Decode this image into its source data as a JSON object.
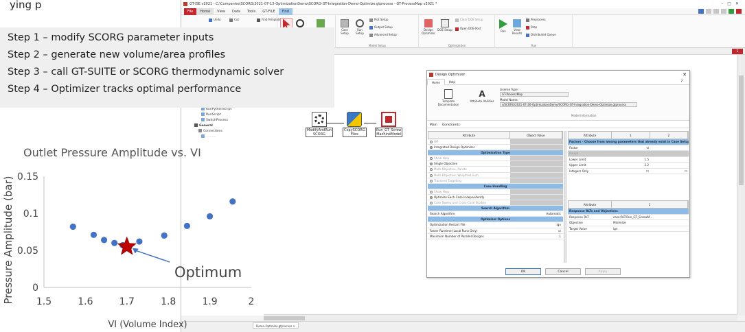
{
  "heading_partial": "ying p",
  "steps": [
    "Step 1 – modify SCORG parameter inputs",
    "Step 2 – generate new volume/area profiles",
    "Step 3 – call GT-SUITE or SCORG thermodynamic solver",
    "Step 4 – Optimizer tracks optimal performance"
  ],
  "app": {
    "title": "GT-ISE v2021 - C:\\Companies\\SCORG\\2021-07-13-OptimizationDemo\\SCORG-GT-Integration-Demo-Optimize.gtprocess - GT-ProcessMap v2021 *",
    "menu": [
      "File",
      "Home",
      "View",
      "Data",
      "Tools",
      "GT-FILE",
      "Find"
    ],
    "ribbon": {
      "undo": "Undo",
      "cut": "Cut",
      "find": "Find Template",
      "value": "d Value",
      "select": "Select",
      "link": "Link",
      "edit_parts": "Edit Parts in Spreadsheet",
      "case_setup": "Case Setup",
      "run_setup": "Run Setup",
      "plot_setup": "Plot Setup",
      "output_setup": "Output Setup",
      "advanced_setup": "Advanced Setup",
      "design_optimizer": "Design Optimizer",
      "doe_setup": "DOE Setup",
      "clear_doe_setup": "Clear DOE Setup",
      "open_doe_post": "Open DOE-Post",
      "run": "Run",
      "view_results": "View Results",
      "preprocess": "Preprocess",
      "stop": "Stop",
      "distributed_queue": "Distributed Queue",
      "group_map_mode": "Map Mode",
      "group_model_setup": "Model Setup",
      "group_optimization": "Optimization",
      "group_run": "Run"
    },
    "tree": [
      {
        "label": "RunPythonScript",
        "bold": false
      },
      {
        "label": "RunScript",
        "bold": false
      },
      {
        "label": "SwitchProcess",
        "bold": false
      },
      {
        "label": "General",
        "bold": true
      },
      {
        "label": "Connections",
        "bold": false
      }
    ],
    "blocks": [
      {
        "label": "ModifyAndRun\nSCORG",
        "color": "#4a4a4a"
      },
      {
        "label": "CopySCORG\nFiles",
        "color": "#f2b705"
      },
      {
        "label": "Run_GT_Screw\nMachineModel",
        "color": "#c0282d"
      }
    ],
    "flag": "1",
    "status_tab": "Demo-Optimize.gtprocess ×"
  },
  "chart_data": {
    "type": "scatter",
    "title": "Outlet Pressure Amplitude vs. VI",
    "xlabel": "VI (Volume Index)",
    "ylabel": "Pressure Amplitude (bar)",
    "xlim": [
      1.5,
      2
    ],
    "ylim": [
      0,
      0.15
    ],
    "xticks": [
      "1.5",
      "1.6",
      "1.7",
      "1.8",
      "1.9",
      "2"
    ],
    "yticks": [
      "0",
      "0.05",
      "0.1",
      "0.15"
    ],
    "points": [
      {
        "x": 1.57,
        "y": 0.082
      },
      {
        "x": 1.62,
        "y": 0.071
      },
      {
        "x": 1.645,
        "y": 0.064
      },
      {
        "x": 1.67,
        "y": 0.06
      },
      {
        "x": 1.69,
        "y": 0.057
      },
      {
        "x": 1.705,
        "y": 0.054
      },
      {
        "x": 1.73,
        "y": 0.062
      },
      {
        "x": 1.79,
        "y": 0.07
      },
      {
        "x": 1.845,
        "y": 0.083
      },
      {
        "x": 1.9,
        "y": 0.096
      },
      {
        "x": 1.955,
        "y": 0.116
      }
    ],
    "optimum": {
      "x": 1.7,
      "y": 0.055,
      "label": "Optimum"
    },
    "marker_color": "#4472c4",
    "star_color": "#c00000"
  },
  "dialog": {
    "title": "Design Optimizer",
    "tabs": [
      "Home",
      "Help"
    ],
    "help_glyph": "?",
    "template_doc": "Template Documentation",
    "attribute_abilities": "Attribute Abilities",
    "license_type_label": "License Type:",
    "license_type_value": "GT-ProcessMap",
    "model_name_label": "Model Name:",
    "model_name_value": "s/SCORG/2021-07-26-OptimizationDemo/SCORG-GT-Integration-Demo-Optimize.gtprocess",
    "model_info": "Model Information",
    "subtabs": [
      "Main",
      "Constraints"
    ],
    "left_header": [
      "Attribute",
      "Object Value"
    ],
    "left_rows": [
      {
        "kind": "row",
        "ctrl": "radio",
        "on": false,
        "label": "Off",
        "dis": true
      },
      {
        "kind": "row",
        "ctrl": "radio",
        "on": true,
        "label": "Integrated Design Optimizer",
        "dis": false
      },
      {
        "kind": "sec",
        "label": "Optimization Type"
      },
      {
        "kind": "row",
        "ctrl": "radio",
        "on": false,
        "label": "Show Help",
        "dis": true
      },
      {
        "kind": "row",
        "ctrl": "radio",
        "on": true,
        "label": "Single Objective",
        "dis": false
      },
      {
        "kind": "row",
        "ctrl": "radio",
        "on": false,
        "label": "Multi-Objective, Pareto",
        "dis": true
      },
      {
        "kind": "row",
        "ctrl": "radio",
        "on": false,
        "label": "Multi-Objective, Weighted Sum",
        "dis": true
      },
      {
        "kind": "row",
        "ctrl": "radio",
        "on": false,
        "label": "Transient Targeting",
        "dis": true
      },
      {
        "kind": "sec",
        "label": "Case Handling"
      },
      {
        "kind": "row",
        "ctrl": "radio",
        "on": false,
        "label": "Show Help",
        "dis": true
      },
      {
        "kind": "row",
        "ctrl": "radio",
        "on": true,
        "label": "Optimize Each Case Independently",
        "dis": false
      },
      {
        "kind": "row",
        "ctrl": "radio",
        "on": false,
        "label": "Case Sweep and Cross-Case Studies",
        "dis": true
      },
      {
        "kind": "sec",
        "label": "Search Algorithm"
      },
      {
        "kind": "row",
        "ctrl": "none",
        "label": "Search Algorithm",
        "value": "Automatic",
        "white": true
      },
      {
        "kind": "sec",
        "label": "Optimizer Options"
      },
      {
        "kind": "row",
        "ctrl": "none",
        "label": "Optimization Restart File",
        "value": "ign",
        "white": true
      },
      {
        "kind": "row",
        "ctrl": "none",
        "label": "Faster Runtime (Local Runs Only)",
        "value": "☑",
        "white": true
      },
      {
        "kind": "row",
        "ctrl": "none",
        "label": "Maximum Number of Parallel Designs",
        "value": "1",
        "white": true
      }
    ],
    "right_header": [
      "Attribute",
      "1",
      "2"
    ],
    "right_rows": [
      {
        "kind": "sec",
        "label": "Factors - Choose from among parameters that already exist in Case Setup"
      },
      {
        "kind": "row",
        "a": "Factor",
        "b": "vi",
        "c": "",
        "grey": false
      },
      {
        "kind": "row",
        "a": "Range",
        "b": "",
        "c": "",
        "grey": true,
        "dis": true
      },
      {
        "kind": "row",
        "a": "Lower Limit",
        "b": "1.5",
        "c": "",
        "grey": false
      },
      {
        "kind": "row",
        "a": "Upper Limit",
        "b": "2.2",
        "c": "",
        "grey": false
      },
      {
        "kind": "row",
        "a": "Integers Only",
        "b": "☐",
        "c": "☐",
        "grey": false
      }
    ],
    "right2_header": [
      "Attribute",
      "1"
    ],
    "right2_rows": [
      {
        "kind": "sec",
        "label": "Response RLTs and Objectives"
      },
      {
        "kind": "row",
        "a": "Response RLT",
        "b": "case:RLT:Run_GT_ScrewM..."
      },
      {
        "kind": "row",
        "a": "Objective",
        "b": "Minimize"
      },
      {
        "kind": "row",
        "a": "Target Value",
        "b": "ign"
      }
    ],
    "buttons": [
      "OK",
      "Cancel",
      "Apply"
    ]
  }
}
